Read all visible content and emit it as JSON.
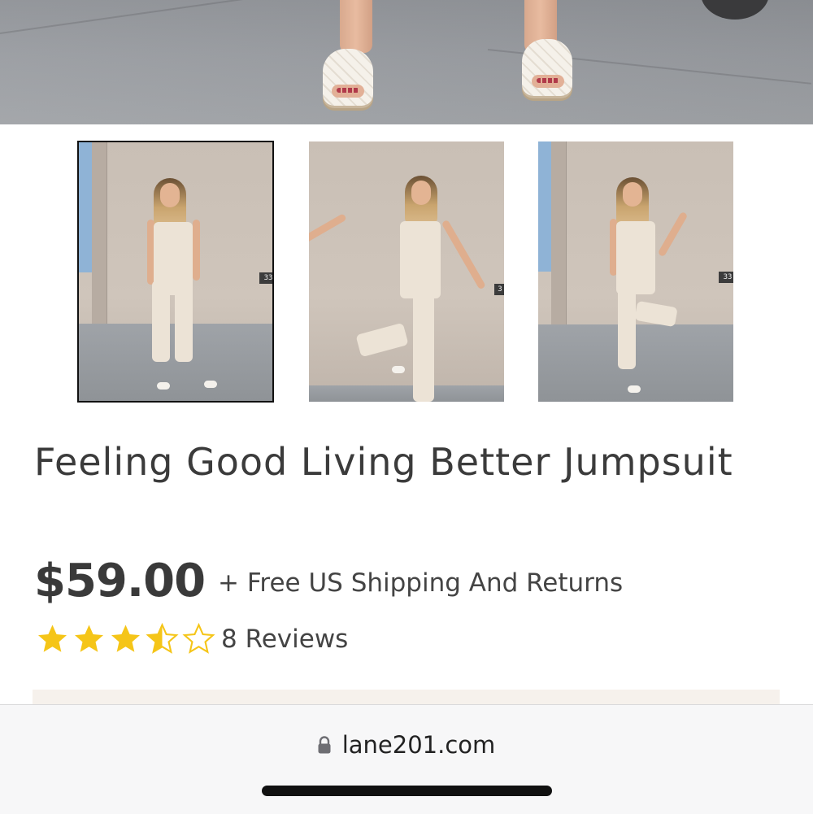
{
  "product": {
    "title": "Feeling Good Living Better Jumpsuit",
    "price": "$59.00",
    "shipping": "+ Free US Shipping And Returns",
    "rating": 3.5,
    "rating_max": 5,
    "reviews_label": "8 Reviews",
    "star_color": "#f5c518"
  },
  "gallery": {
    "selected_index": 0,
    "thumbnails": [
      {
        "name": "thumbnail-1",
        "sign_text": "33"
      },
      {
        "name": "thumbnail-2",
        "sign_text": "3"
      },
      {
        "name": "thumbnail-3",
        "sign_text": "33"
      }
    ]
  },
  "browser": {
    "url": "lane201.com",
    "lock_icon": "lock-icon"
  }
}
